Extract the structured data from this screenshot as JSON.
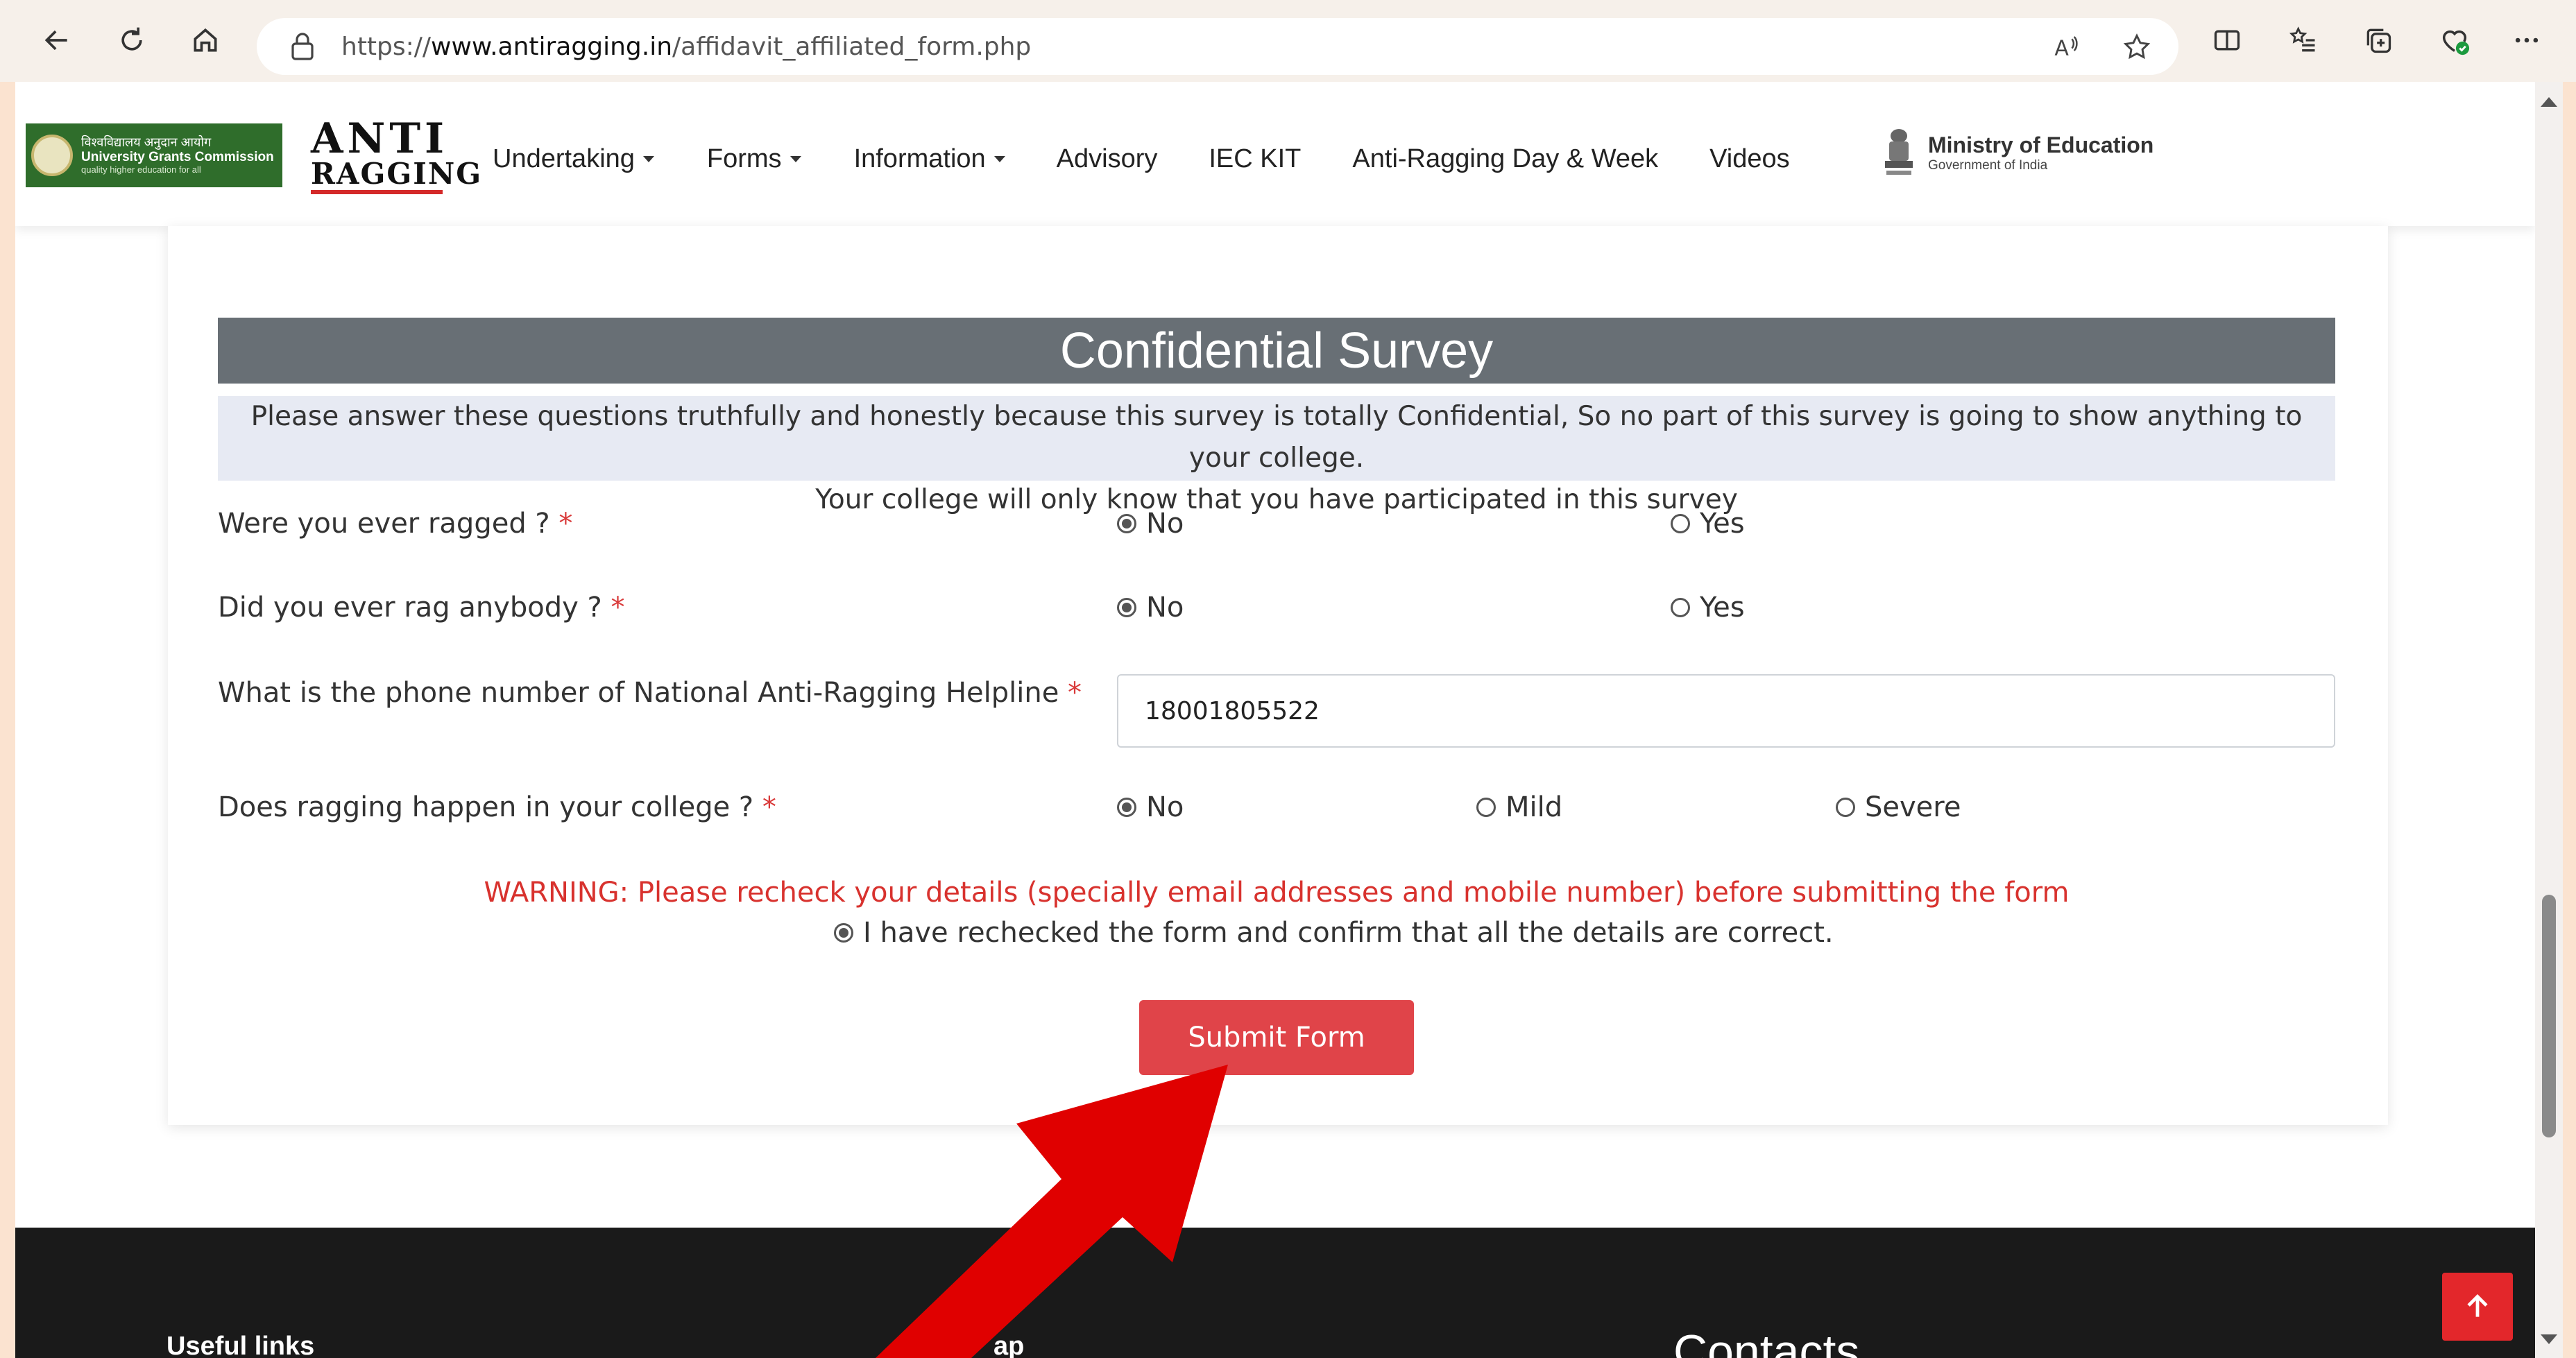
{
  "browser": {
    "url_prefix": "https://",
    "url_domain": "www.antiragging.in",
    "url_path": "/affidavit_affiliated_form.php",
    "icons": [
      "back-arrow-icon",
      "refresh-icon",
      "home-icon",
      "lock-icon",
      "read-aloud-icon",
      "favorite-star-icon",
      "split-screen-icon",
      "favorites-list-icon",
      "collections-icon",
      "browser-essentials-icon",
      "more-options-icon"
    ]
  },
  "header": {
    "ugc_line1": "विश्वविद्यालय अनुदान आयोग",
    "ugc_line2": "University Grants Commission",
    "ugc_line3": "quality higher education for all",
    "anti_top": "ANTI",
    "anti_bottom": "RAGGING",
    "nav": [
      {
        "label": "Undertaking",
        "dropdown": true
      },
      {
        "label": "Forms",
        "dropdown": true
      },
      {
        "label": "Information",
        "dropdown": true
      },
      {
        "label": "Advisory",
        "dropdown": false
      },
      {
        "label": "IEC KIT",
        "dropdown": false
      },
      {
        "label": "Anti-Ragging Day & Week",
        "dropdown": false
      },
      {
        "label": "Videos",
        "dropdown": false
      }
    ],
    "moe_title": "Ministry of Education",
    "moe_sub": "Government of India"
  },
  "survey": {
    "title": "Confidential Survey",
    "note_line1": "Please answer these questions truthfully and honestly because this survey is totally Confidential, So no part of this survey is going to show anything to your college.",
    "note_line2": "Your college will only know that you have participated in this survey",
    "required_mark": "*",
    "q1": {
      "label": "Were you ever ragged ?",
      "opt1": "No",
      "opt2": "Yes",
      "selected": "No"
    },
    "q2": {
      "label": "Did you ever rag anybody ?",
      "opt1": "No",
      "opt2": "Yes",
      "selected": "No"
    },
    "q3": {
      "label": "What is the phone number of National Anti-Ragging Helpline",
      "value": "18001805522"
    },
    "q4": {
      "label": "Does ragging happen in your college ?",
      "opt1": "No",
      "opt2": "Mild",
      "opt3": "Severe",
      "selected": "No"
    },
    "warning": "WARNING: Please recheck your details (specially email addresses and mobile number) before submitting the form",
    "confirm": "I have rechecked the form and confirm that all the details are correct.",
    "submit_label": "Submit Form"
  },
  "footer": {
    "useful_links": "Useful links",
    "sitemap_partial": "ap",
    "contacts": "Contacts"
  },
  "colors": {
    "accent_red": "#e04449",
    "heading_bg": "#686f75",
    "note_bg": "#e7eaf3",
    "annotation_arrow": "#e00000"
  }
}
